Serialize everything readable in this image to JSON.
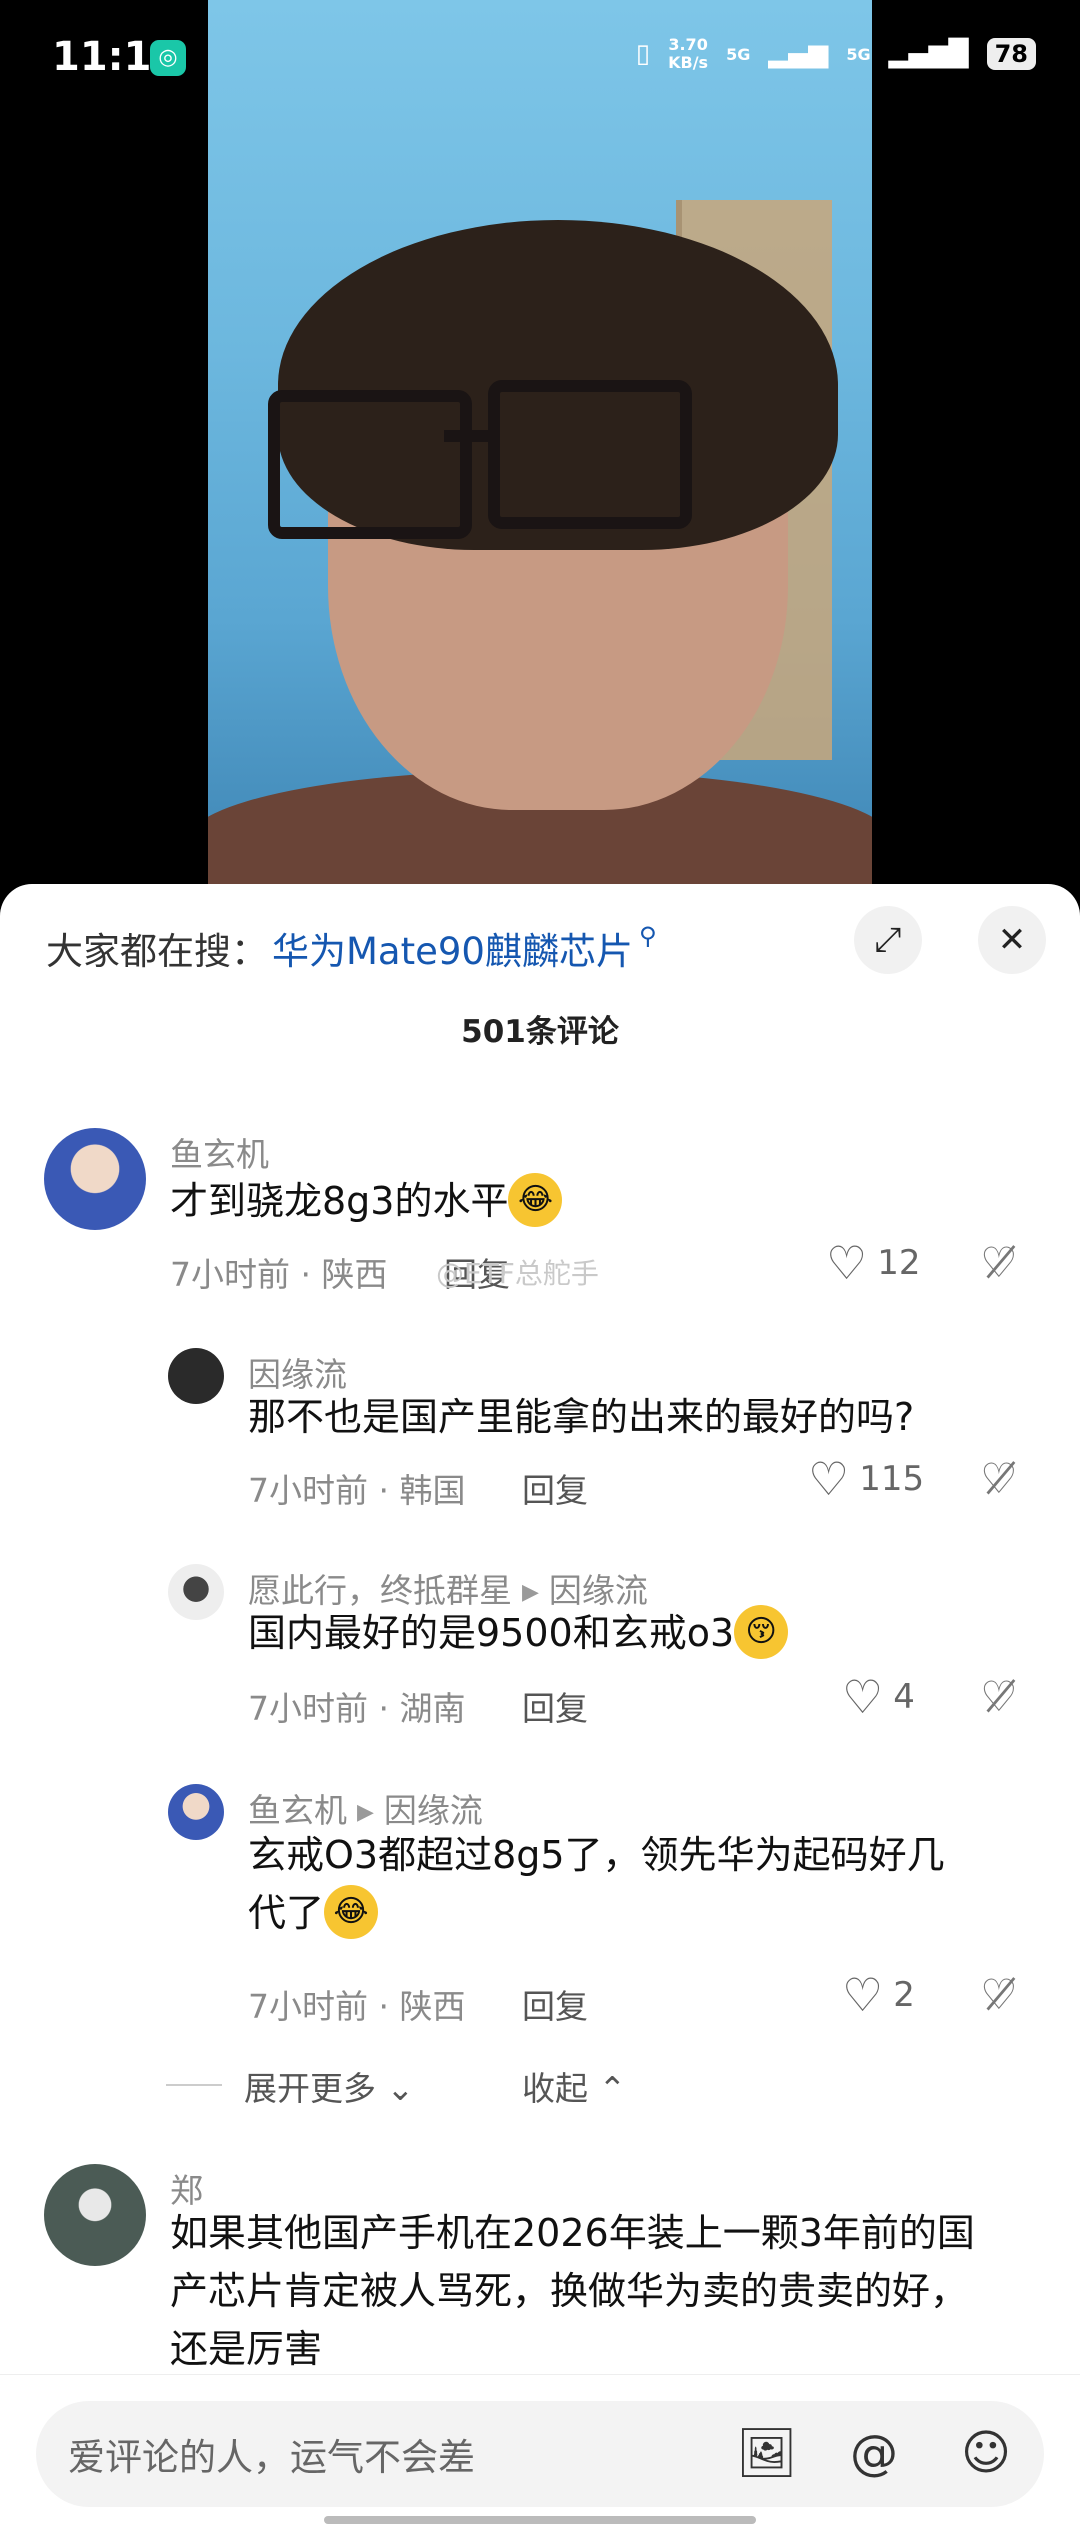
{
  "status": {
    "time": "11:15",
    "net_speed_value": "3.70",
    "net_speed_unit": "KB/s",
    "signal1": "5G",
    "signal2": "5G",
    "battery": "78"
  },
  "search": {
    "label": "大家都在搜：",
    "term": "华为Mate90麒麟芯片"
  },
  "comments_count": "501条评论",
  "comments": [
    {
      "user": "鱼玄机",
      "text": "才到骁龙8g3的水平",
      "time": "7小时前 · 陕西",
      "reply": "回复",
      "likes": "12",
      "watermark": "@ETF总舵手"
    },
    {
      "user": "因缘流",
      "text": "那不也是国产里能拿的出来的最好的吗?",
      "time": "7小时前 · 韩国",
      "reply": "回复",
      "likes": "115"
    },
    {
      "user": "愿此行，终抵群星",
      "reply_to": "因缘流",
      "text": "国内最好的是9500和玄戒o3",
      "time": "7小时前 · 湖南",
      "reply": "回复",
      "likes": "4"
    },
    {
      "user": "鱼玄机",
      "reply_to": "因缘流",
      "text_line1": "玄戒O3都超过8g5了，领先华为起码好几",
      "text_line2": "代了",
      "time": "7小时前 · 陕西",
      "reply": "回复",
      "likes": "2"
    },
    {
      "user": "郑",
      "text_line1": "如果其他国产手机在2026年装上一颗3年前的国",
      "text_line2": "产芯片肯定被人骂死，换做华为卖的贵卖的好，",
      "text_line3": "还是厉害"
    }
  ],
  "thread": {
    "expand_more": "展开更多",
    "collapse": "收起"
  },
  "input": {
    "placeholder": "爱评论的人，运气不会差"
  }
}
